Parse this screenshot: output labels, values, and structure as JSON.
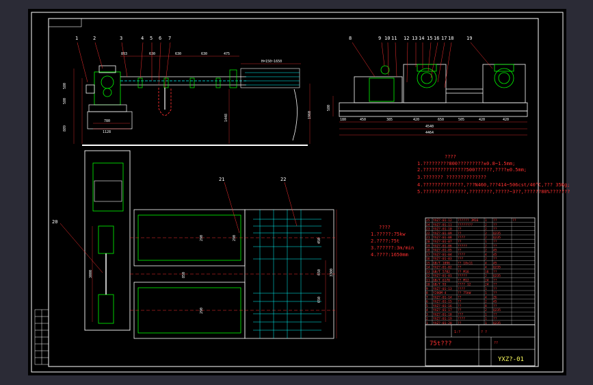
{
  "drawing": {
    "leader_numbers_top": [
      "1",
      "2",
      "3",
      "4",
      "5",
      "6",
      "7"
    ],
    "leader_numbers_right": [
      "8",
      "9",
      "10",
      "11",
      "12",
      "13",
      "14",
      "15",
      "16",
      "17",
      "18",
      "19"
    ],
    "leader_numbers_bottom": [
      "20",
      "21",
      "22"
    ],
    "dims_front_top": [
      "883",
      "630",
      "630",
      "630",
      "475"
    ],
    "dim_front_wide": "H=150~1650",
    "dims_front_left": [
      "580",
      "580",
      "889"
    ],
    "dims_front_bottom": [
      "780",
      "1128"
    ],
    "dim_front_mid": "1448",
    "dim_front_right": "1960",
    "dim_side_left": "580",
    "dims_side_row1": [
      "180",
      "450",
      "385",
      "420",
      "650",
      "505",
      "420",
      "420"
    ],
    "dims_side_row2": [
      "4540",
      "4464"
    ],
    "dims_plan_left": [
      "3000"
    ],
    "dims_plan_mid": [
      "290",
      "290",
      "850",
      "290"
    ],
    "dims_plan_right": [
      "450",
      "650",
      "650",
      "3300"
    ]
  },
  "notes": {
    "heading": "????",
    "lines": [
      "1.?????????800?????????±0.8~1.5mm;",
      "2.???????????????500??????,????±0.5mm;",
      "3.??????? ??????????????",
      "4.??????????????,???N460,???414~506cst/40°C,??? 35Kg;",
      "5.???????????????,????????,?????~3??,??????80%???????"
    ]
  },
  "params": {
    "heading": "????",
    "lines": [
      "1.?????:75kw",
      "2.????:75t",
      "3.??????:3m/min",
      "4.????:1650mm"
    ]
  },
  "bom": {
    "rows": [
      "25|YXZ?-01-12|?????? JM16|1|??|??",
      "24|YXZ?-01-11|????????|2|??",
      "23|YXZ?-01-10|??|2|??",
      "22|YXZ?-01-09|??|2|Q235",
      "21|YXZ?-01-08|????|2|Q235",
      "20|YXZ?-01-07|??|1|??",
      "19|YXZ?-01-06|?????|2|??",
      "18|YXZ?-01-05|??|2|45",
      "17|YXZ?-01-04|????|4|45",
      "16|YXZ?-01-03|???|2|??",
      "15|GB/T 1096|?? 18x11|4|45",
      "14|YXZ?-01-02|??|4|Q235",
      "13|GB/T 5782|?? M16|16|??",
      "12|YXZ?-01-01|?????|2|Q235",
      "11|GB/T 6170|?? M12|24|??",
      "10|GB/T 93|???? 12|24|??",
      "9|YXZ?-01-13|????|1|??",
      "8|Y280M-4|?? 75kW|1|??",
      "7|YXZ?-01-14|??|4|ZG",
      "6|YXZ?-01-15|??|2|45",
      "5|YXZ?-01-16|??|8|??",
      "4|YXZ?-01-17|??|2|Q235",
      "3|YXZ?-01-18|???|1|??",
      "2|YXZ?-01-19|????|1|??",
      "1|YXZ?-01-20|??|1|Q235"
    ],
    "title_block": {
      "name": "75t???",
      "scale": "1:?",
      "drawing_no": "YXZ?-01",
      "material": "??",
      "sheet": "? ?"
    }
  }
}
